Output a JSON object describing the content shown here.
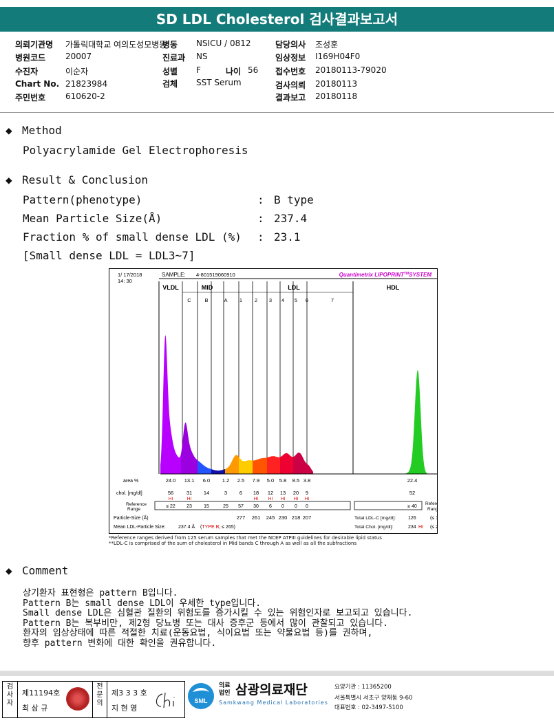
{
  "title": "SD LDL Cholesterol 검사결과보고서",
  "info": {
    "col1": [
      {
        "k": "의뢰기관명",
        "v": "가톨릭대학교 여의도성모병동"
      },
      {
        "k": "병원코드",
        "v": "20007"
      },
      {
        "k": "수진자",
        "v": "이순자"
      },
      {
        "k": "Chart No.",
        "v": "21823984"
      },
      {
        "k": "주민번호",
        "v": "610620-2"
      }
    ],
    "col2": [
      {
        "k": "병동",
        "v": "NSICU / 0812"
      },
      {
        "k": "진료과",
        "v": "NS"
      },
      {
        "k": "성별",
        "v": "F"
      },
      {
        "k": "검체",
        "v": "SST Serum"
      }
    ],
    "age": {
      "k": "나이",
      "v": "56"
    },
    "col3": [
      {
        "k": "담당의사",
        "v": "조성훈"
      },
      {
        "k": "임상정보",
        "v": "I169H04F0"
      },
      {
        "k": "접수번호",
        "v": "20180113-79020"
      },
      {
        "k": "검사의뢰",
        "v": "20180113"
      },
      {
        "k": "결과보고",
        "v": "20180118"
      }
    ]
  },
  "method": {
    "heading": "Method",
    "text": "Polyacrylamide Gel Electrophoresis"
  },
  "result": {
    "heading": "Result & Conclusion",
    "rows": [
      {
        "label": "Pattern(phenotype)",
        "sep": ":",
        "value": "B type"
      },
      {
        "label": "Mean Particle Size(Å)",
        "sep": ":",
        "value": "237.4"
      },
      {
        "label": "Fraction % of small dense LDL (%)",
        "sep": ":",
        "value": "23.1"
      }
    ],
    "note": "[Small dense LDL = LDL3~7]"
  },
  "chart_data": {
    "type": "area",
    "date": "1/ 17/2018",
    "time": "14: 30",
    "sample_label": "SAMPLE:",
    "sample_id": "4-801519060910",
    "brand": "Quantimetrix LIPOPRINT",
    "brand_tm": "TM",
    "brand_suffix": "SYSTEM",
    "groups": [
      "VLDL",
      "MID",
      "LDL",
      "HDL"
    ],
    "bands": [
      "C",
      "B",
      "A",
      "1",
      "2",
      "3",
      "4",
      "5",
      "6",
      "7"
    ],
    "area_label": "area %",
    "area": [
      "24.0",
      "13.1",
      "6.0",
      "1.2",
      "2.5",
      "7.9",
      "5.0",
      "5.8",
      "8.5",
      "3.8",
      "22.4"
    ],
    "chol_label": "chol. [mg/dl]",
    "chol": [
      "56",
      "31",
      "14",
      "3",
      "6",
      "18",
      "12",
      "13",
      "20",
      "9",
      "52"
    ],
    "chol_flags": [
      "HI",
      "HI",
      "",
      "",
      "",
      "HI",
      "HI",
      "HI",
      "HI",
      "HI"
    ],
    "ref_label": [
      "Reference",
      "Range"
    ],
    "ref": [
      "≤ 22",
      "23",
      "15",
      "25",
      "57",
      "30",
      "6",
      "0",
      "0",
      "0"
    ],
    "ref_hdl": "≥ 40",
    "ref_right": [
      "Reference",
      "Range"
    ],
    "particle_label": "Particle-Size (Å)",
    "particle": [
      "277",
      "261",
      "245",
      "230",
      "218",
      "207"
    ],
    "mean_label": "Mean LDL-Particle Size:",
    "mean_value": "237.4 Å",
    "mean_type": "TYPE B",
    "mean_tail": "; ≤ 265)",
    "total_ldl_label": "Total LDL-C [mg/dl]:",
    "total_ldl": "126",
    "total_ldl_ref": "(≤ 130)",
    "total_chol_label": "Total Chol. [mg/dl]:",
    "total_chol": "234",
    "total_chol_flag": "HI",
    "total_chol_ref": "(≤ 200)",
    "colors": {
      "vldl": "#b800ff",
      "mid_c": "#9b00e0",
      "mid_b": "#2255ff",
      "mid_a": "#1111aa",
      "ldl1": "#ff9900",
      "ldl2": "#ffcc00",
      "ldl3": "#ff5500",
      "ldl4": "#ff2222",
      "ldl5": "#ee0033",
      "ldl6": "#cc0044",
      "hdl": "#22cc22",
      "brand": "#cc00cc",
      "flag": "#dd0000"
    }
  },
  "footnotes": [
    "*Reference ranges derived from 125 serum samples that met the NCEP ATPIII guidelines for desirable lipid status",
    "**LDL-C is comprised of the sum of cholesterol in Mid bands C through A as well as all the subfractions"
  ],
  "comment": {
    "heading": "Comment",
    "lines": [
      "상기환자 표현형은 pattern B입니다.",
      "Pattern B는 small dense LDL이 우세한 type입니다.",
      "Small dense LDL은 심혈관 질환의 위험도를 증가시킬 수 있는 위험인자로 보고되고 있습니다.",
      "Pattern B는 복부비만, 제2형 당뇨병 또는 대사 증후군 등에서 많이 관찰되고 있습니다.",
      "환자의 임상상태에 따른 적절한 치료(운동요법, 식이요법 또는 약물요법 등)를 권하며,",
      "향후 pattern 변화에 대한 확인을 권유합니다."
    ]
  },
  "footer": {
    "tester_v": "검사자",
    "tester_no": "제11194호",
    "tester_name": "최 삼 규",
    "specialist_v": "전문의",
    "specialist_no": "제3 3 3 호",
    "specialist_name": "지 현 영",
    "org_prefix": [
      "의료",
      "법인"
    ],
    "org_name": "삼광의료재단",
    "org_en": "Samkwang Medical Laboratories",
    "logo_text": "SML",
    "addr1": "요양기관 : 11365200",
    "addr2": "서울특별시 서초구 양재동 9-60",
    "addr3": "대표번호 : 02-3497-5100"
  }
}
